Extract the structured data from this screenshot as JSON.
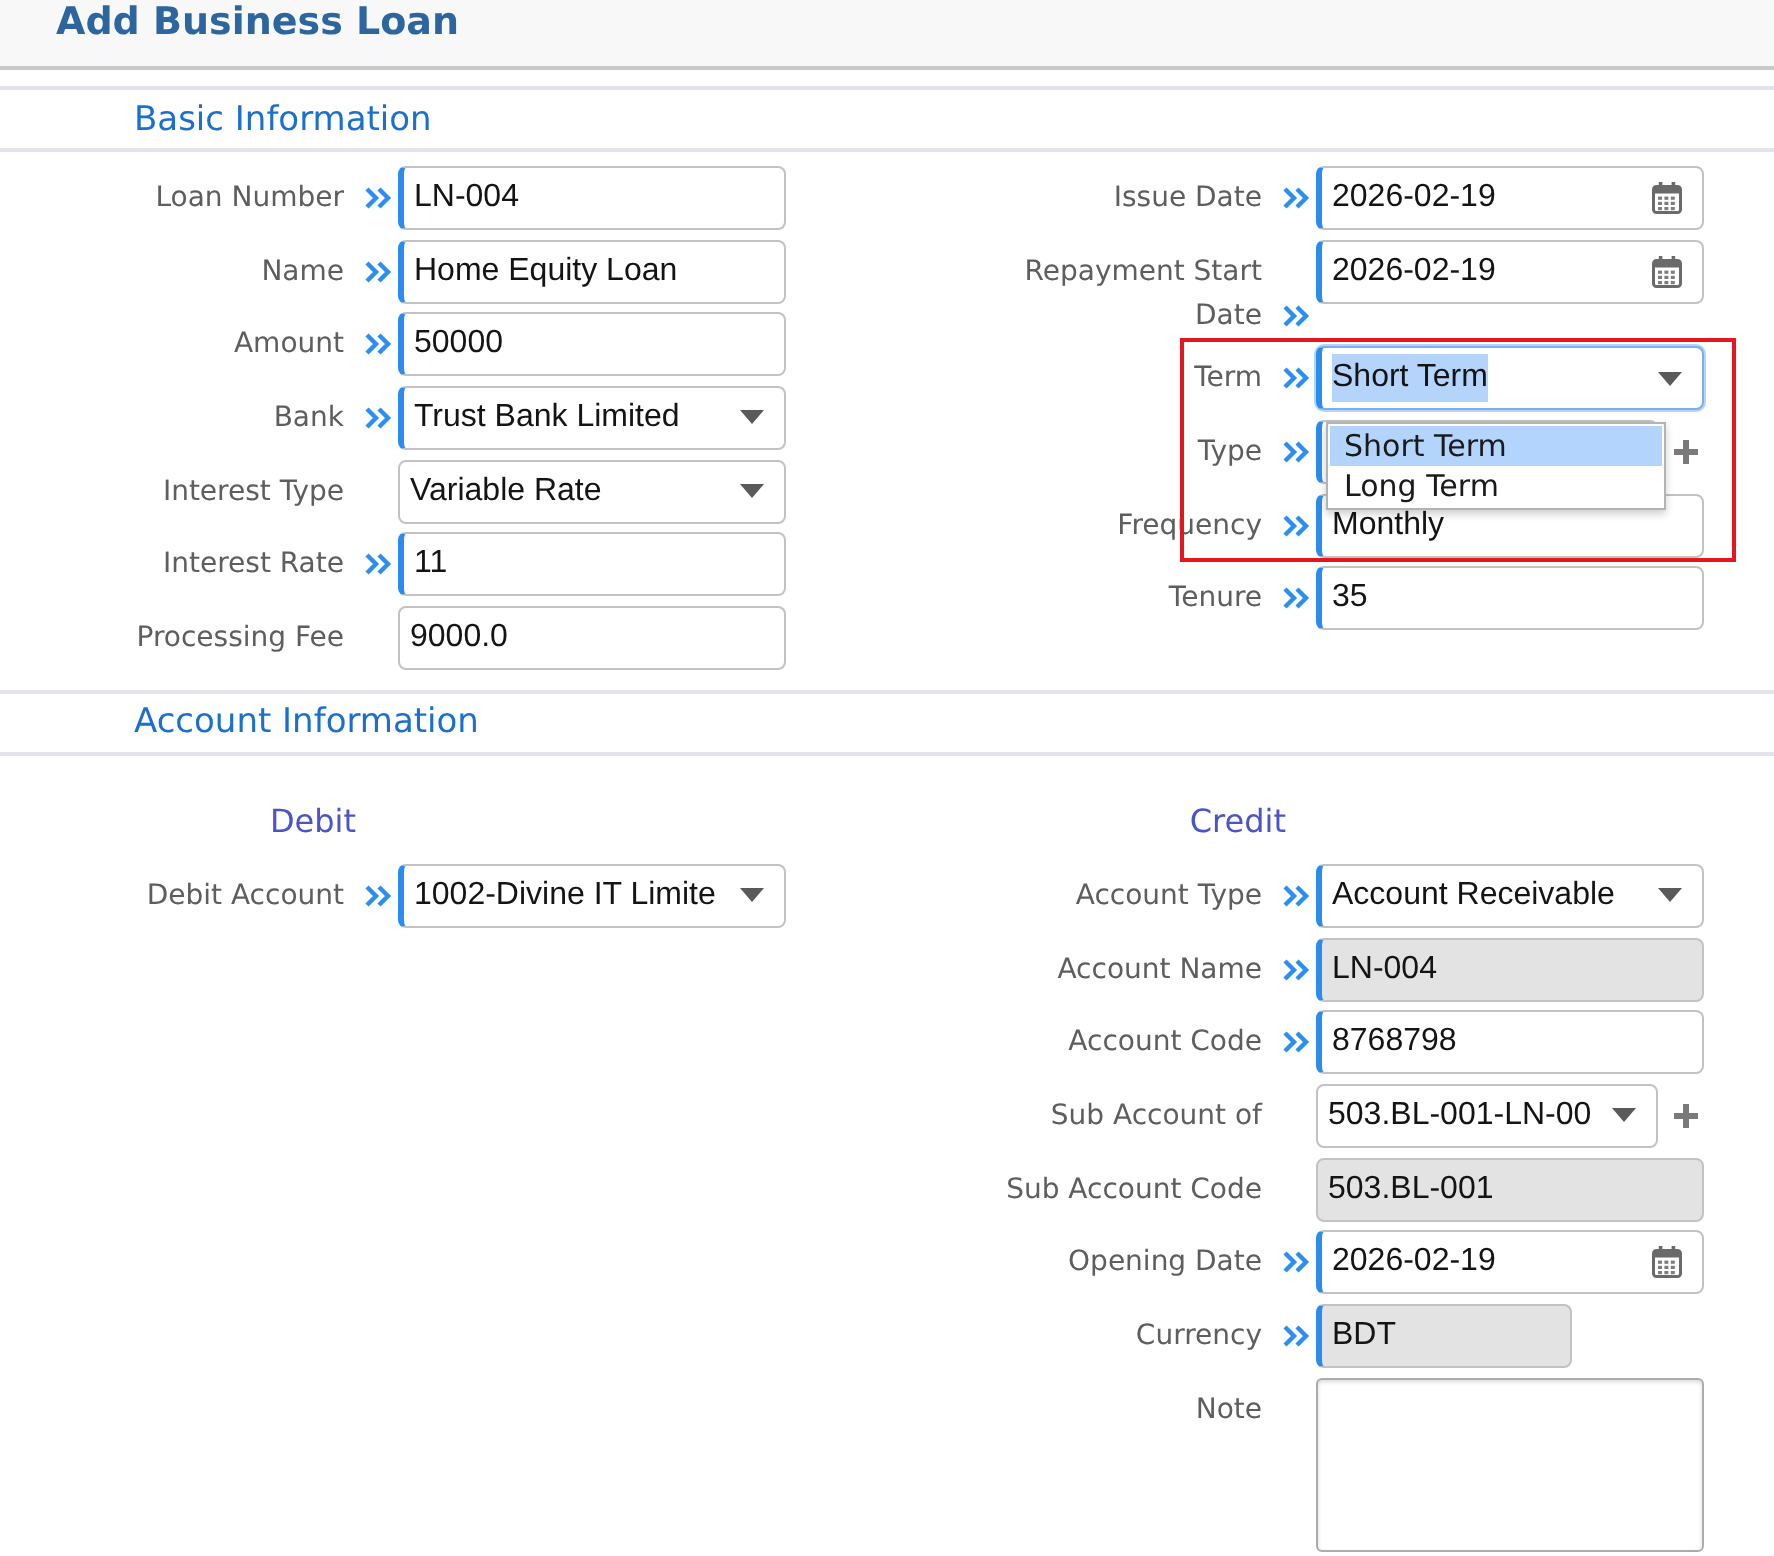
{
  "title": "Add Business Loan",
  "basic_information": {
    "heading": "Basic Information",
    "left_fields": [
      {
        "label": "Loan Number",
        "kind": "text",
        "value": "LN-004",
        "required": true,
        "disabled": false,
        "focused": false
      },
      {
        "label": "Name",
        "kind": "text",
        "value": "Home Equity Loan",
        "required": true,
        "disabled": false,
        "focused": false
      },
      {
        "label": "Amount",
        "kind": "text",
        "value": "50000",
        "required": true,
        "disabled": false,
        "focused": false
      },
      {
        "label": "Bank",
        "kind": "select",
        "value": "Trust Bank Limited",
        "required": true,
        "disabled": false,
        "focused": false
      },
      {
        "label": "Interest Type",
        "kind": "select",
        "value": "Variable Rate",
        "required": false,
        "disabled": false,
        "focused": false
      },
      {
        "label": "Interest Rate",
        "kind": "text",
        "value": "11",
        "required": true,
        "disabled": false,
        "focused": false
      },
      {
        "label": "Processing Fee",
        "kind": "text",
        "value": "9000.0",
        "required": false,
        "disabled": false,
        "focused": false
      }
    ],
    "right_fields": [
      {
        "label": "Issue Date",
        "kind": "date",
        "value": "2026-02-19",
        "required": true,
        "disabled": false,
        "focused": false
      },
      {
        "label": "Repayment Start Date",
        "kind": "date",
        "value": "2026-02-19",
        "required": true,
        "disabled": false,
        "focused": false
      },
      {
        "label": "Term",
        "kind": "select",
        "value": "Short Term",
        "required": true,
        "disabled": false,
        "focused": true,
        "options": [
          {
            "label": "Short Term",
            "selected": true
          },
          {
            "label": "Long Term",
            "selected": false
          }
        ]
      },
      {
        "label": "Type",
        "kind": "select",
        "required": true,
        "disabled": false,
        "focused": false,
        "add_button": true
      },
      {
        "label": "Frequency",
        "kind": "text",
        "value": "Monthly",
        "required": true,
        "disabled": false,
        "focused": false
      },
      {
        "label": "Tenure",
        "kind": "text",
        "value": "35",
        "required": true,
        "disabled": false,
        "focused": false
      }
    ]
  },
  "account_information": {
    "heading": "Account Information",
    "debit": {
      "heading": "Debit",
      "fields": [
        {
          "label": "Debit Account",
          "kind": "select",
          "value": "1002-Divine IT Limite",
          "required": true,
          "disabled": false,
          "focused": false
        }
      ]
    },
    "credit": {
      "heading": "Credit",
      "fields": [
        {
          "label": "Account Type",
          "kind": "select",
          "value": "Account Receivable",
          "required": true,
          "disabled": false,
          "focused": false
        },
        {
          "label": "Account Name",
          "kind": "text",
          "value": "LN-004",
          "required": true,
          "disabled": true,
          "focused": false
        },
        {
          "label": "Account Code",
          "kind": "text",
          "value": "8768798",
          "required": true,
          "disabled": false,
          "focused": false
        },
        {
          "label": "Sub Account of",
          "kind": "select",
          "value": "503.BL-001-LN-00",
          "required": false,
          "disabled": false,
          "focused": false,
          "add_button": true
        },
        {
          "label": "Sub Account Code",
          "kind": "text",
          "value": "503.BL-001",
          "required": false,
          "disabled": true,
          "focused": false
        },
        {
          "label": "Opening Date",
          "kind": "date",
          "value": "2026-02-19",
          "required": true,
          "disabled": false,
          "focused": false
        },
        {
          "label": "Currency",
          "kind": "currency",
          "value": "BDT",
          "required": true,
          "disabled": true,
          "focused": false
        },
        {
          "label": "Note",
          "kind": "textarea",
          "required": false,
          "disabled": false,
          "focused": false
        }
      ]
    }
  }
}
